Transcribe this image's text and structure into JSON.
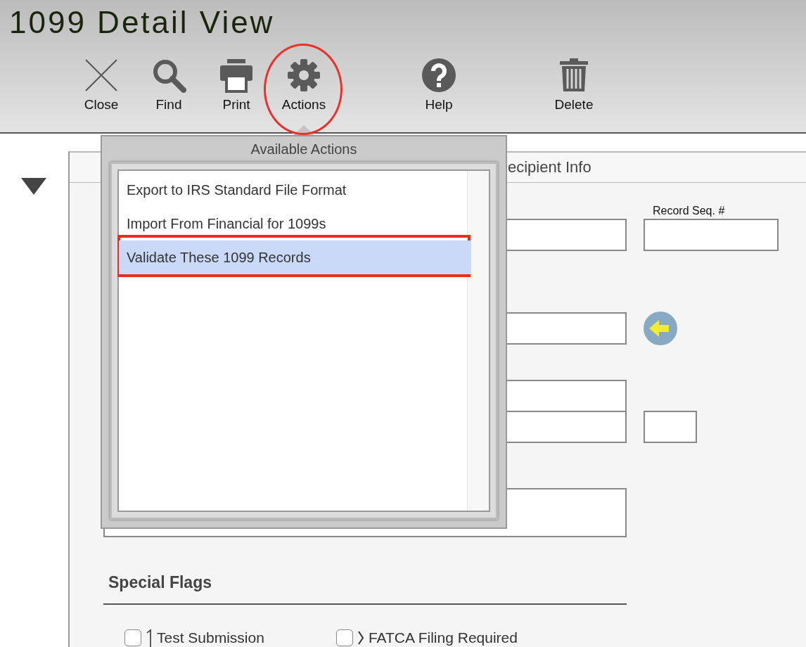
{
  "window": {
    "title": "1099 Detail View"
  },
  "toolbar": [
    {
      "label": "Close",
      "kind": "close"
    },
    {
      "label": "Find",
      "kind": "search"
    },
    {
      "label": "Print",
      "kind": "print"
    },
    {
      "label": "Actions",
      "kind": "gear"
    },
    {
      "label": "Help",
      "kind": "help"
    },
    {
      "label": "Delete",
      "kind": "trash"
    }
  ],
  "actions_menu": {
    "title": "Available Actions",
    "items": [
      {
        "label": "Export to IRS Standard File Format",
        "selected": false
      },
      {
        "label": "Import From Financial for 1099s",
        "selected": false
      },
      {
        "label": "Validate These 1099 Records",
        "selected": true
      }
    ]
  },
  "panel": {
    "title": "ecipient Info",
    "record_seq_label": "Record Seq. #",
    "special_flags": {
      "title": "Special Flags",
      "flags": [
        {
          "label": "Test Submission",
          "checked": false
        },
        {
          "label": "FATCA Filing Required",
          "checked": false
        }
      ]
    }
  }
}
